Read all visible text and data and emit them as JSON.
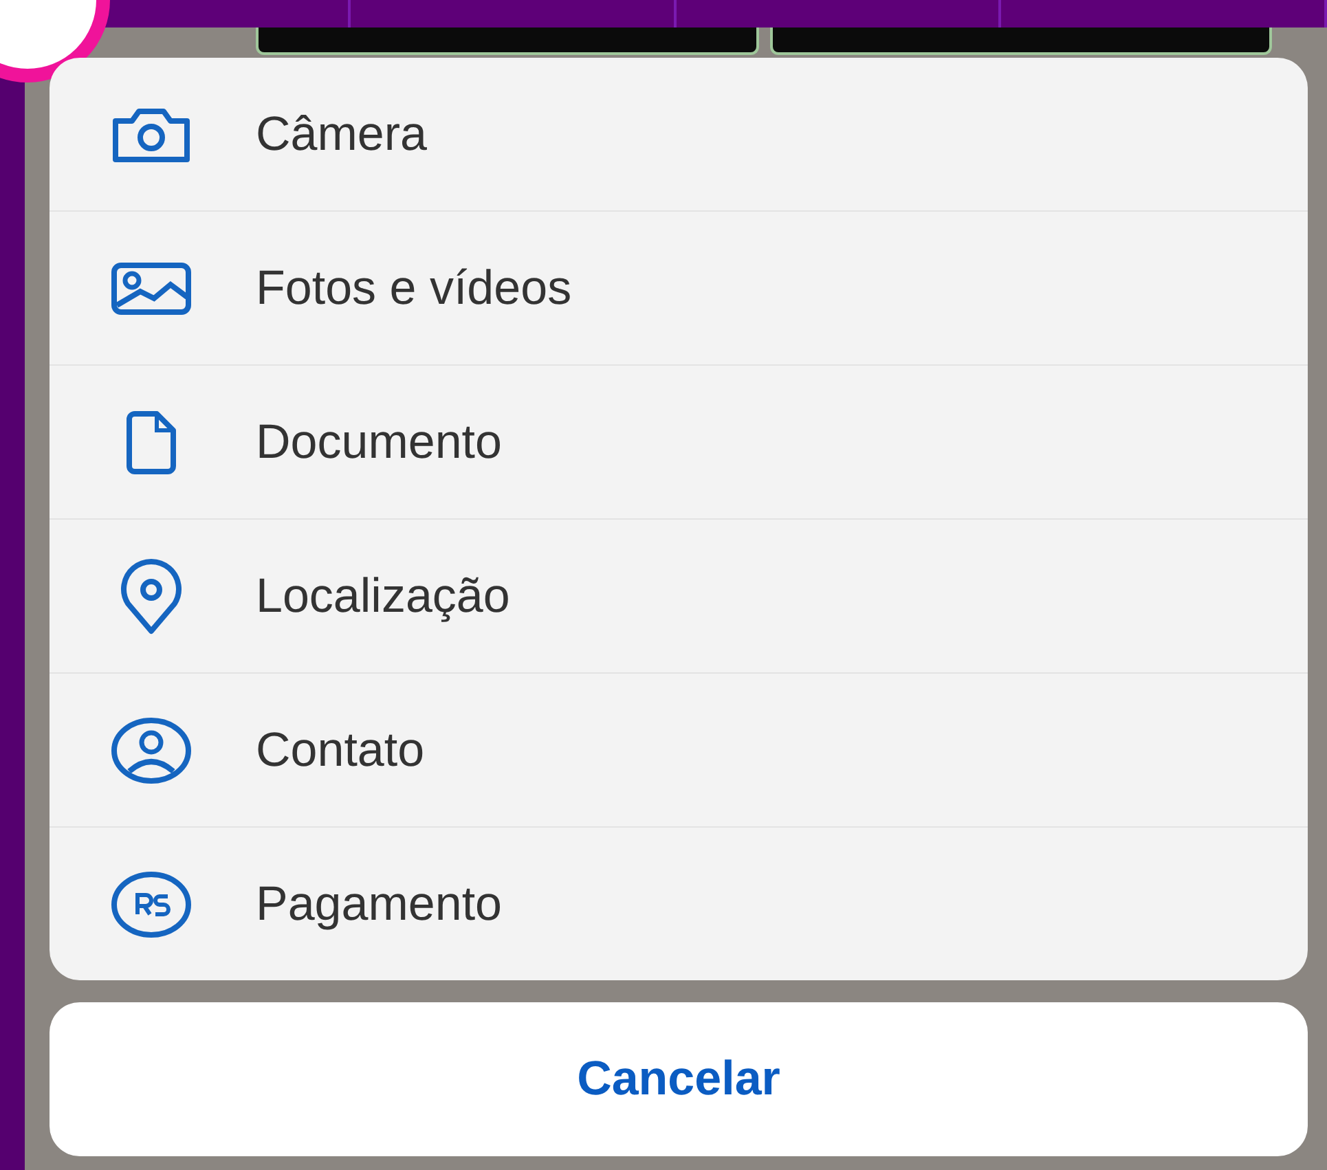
{
  "options": [
    {
      "kind": "camera",
      "label": "Câmera"
    },
    {
      "kind": "photos",
      "label": "Fotos e vídeos"
    },
    {
      "kind": "document",
      "label": "Documento"
    },
    {
      "kind": "location",
      "label": "Localização"
    },
    {
      "kind": "contact",
      "label": "Contato"
    },
    {
      "kind": "payment",
      "label": "Pagamento"
    }
  ],
  "cancel_button": "Cancelar"
}
